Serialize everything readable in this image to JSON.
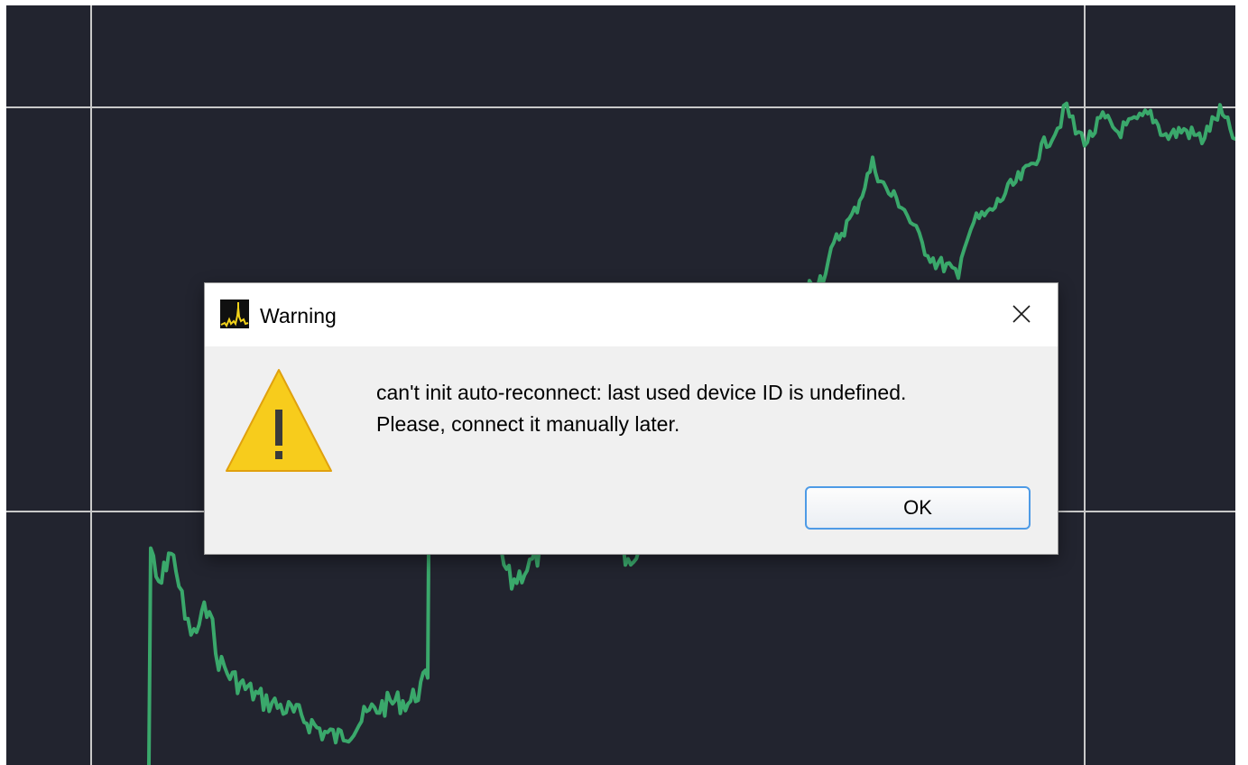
{
  "plot": {
    "background_color": "#22242f",
    "grid_color": "#c9c9c9",
    "series_color": "#3aa86b"
  },
  "dialog": {
    "title": "Warning",
    "app_icon": "spectrum-analyzer-app-icon",
    "close_icon": "close-icon",
    "status_icon": "warning-triangle-icon",
    "message_lines": [
      "can't init auto-reconnect: last used device ID is undefined.",
      "Please, connect it manually later."
    ],
    "ok_label": "OK",
    "accent_color": "#4e9be6",
    "warning_color": "#f7cc1c"
  }
}
